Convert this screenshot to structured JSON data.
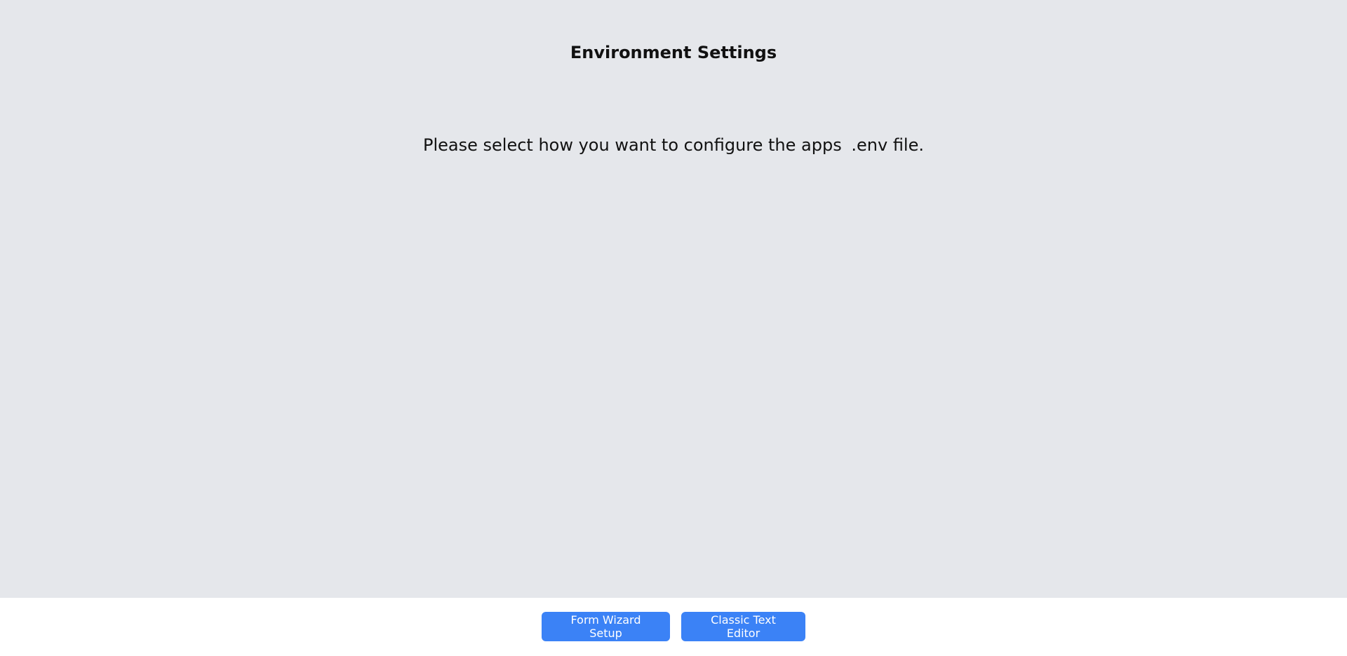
{
  "header": {
    "title": "Environment Settings"
  },
  "main": {
    "prompt_prefix": "Please select how you want to configure the apps",
    "prompt_code": ".env",
    "prompt_suffix": "file."
  },
  "footer": {
    "wizard_label": "Form Wizard Setup",
    "editor_label": "Classic Text Editor"
  },
  "colors": {
    "panel_bg": "#e5e7eb",
    "button_bg": "#3b82f6",
    "footer_bg": "#ffffff"
  }
}
